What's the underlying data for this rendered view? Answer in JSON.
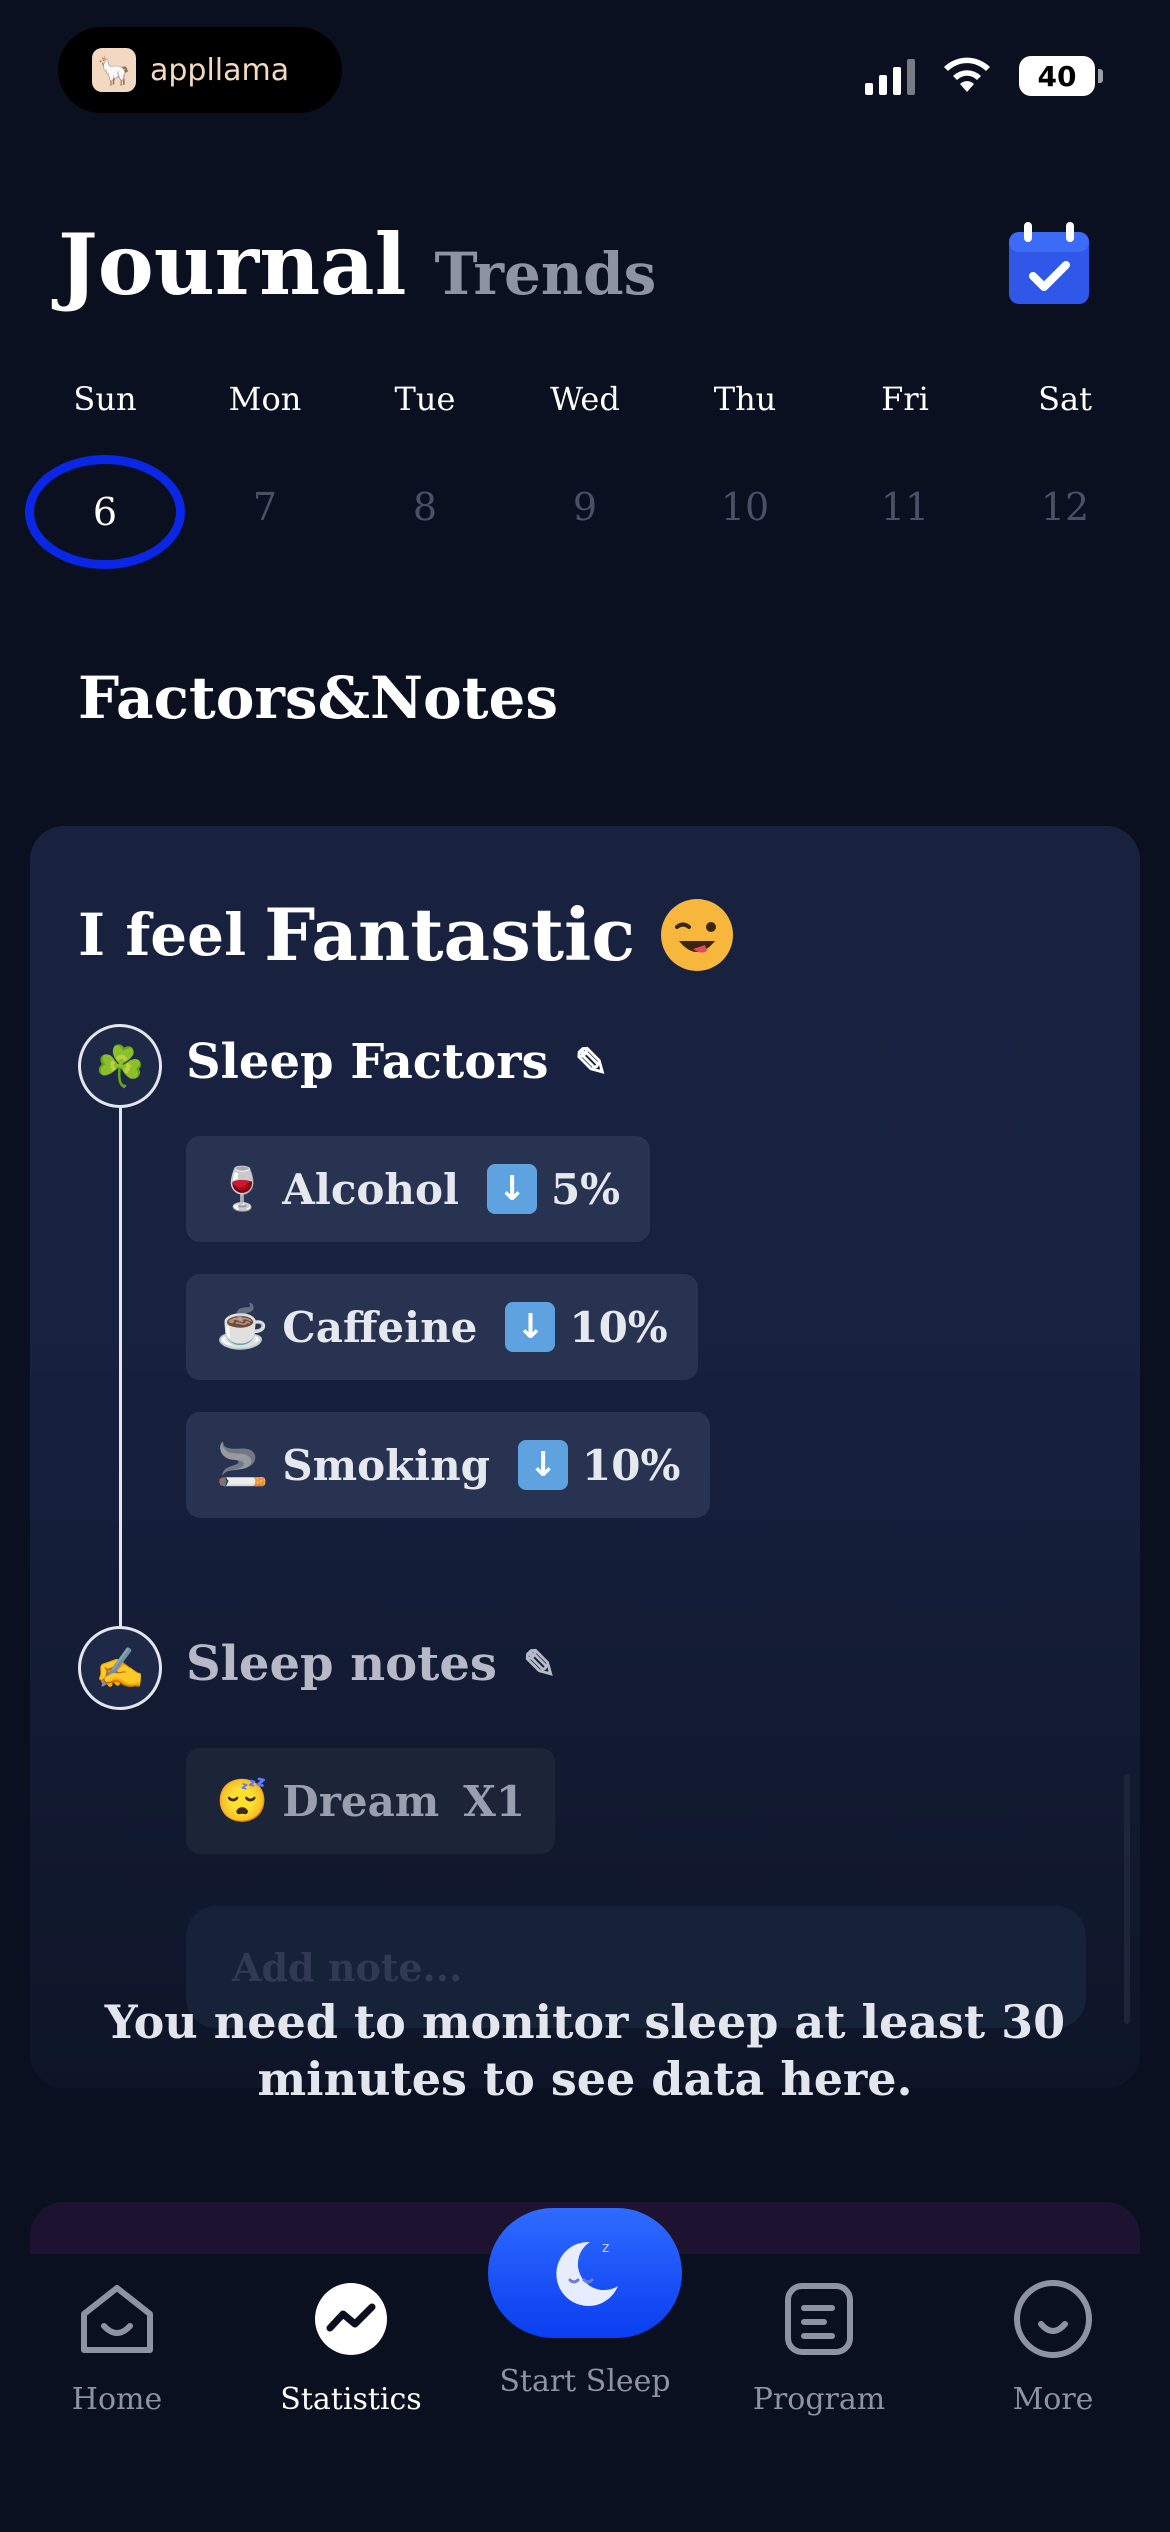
{
  "status_bar": {
    "brand": "appllama",
    "battery": "40"
  },
  "header": {
    "title": "Journal",
    "tab_trends": "Trends"
  },
  "week": {
    "days": [
      "Sun",
      "Mon",
      "Tue",
      "Wed",
      "Thu",
      "Fri",
      "Sat"
    ],
    "dates": [
      "6",
      "7",
      "8",
      "9",
      "10",
      "11",
      "12"
    ],
    "selected_index": 0
  },
  "section": {
    "title": "Factors&Notes"
  },
  "card": {
    "feel_prefix": "I feel",
    "feel_value": "Fantastic",
    "sleep_factors_title": "Sleep Factors",
    "factors": [
      {
        "emoji": "🍷",
        "label": "Alcohol",
        "value": "5%"
      },
      {
        "emoji": "☕",
        "label": "Caffeine",
        "value": "10%"
      },
      {
        "emoji": "🚬",
        "label": "Smoking",
        "value": "10%"
      }
    ],
    "sleep_notes_title": "Sleep notes",
    "notes": [
      {
        "emoji": "😴",
        "label": "Dream",
        "count": "X1"
      }
    ],
    "add_note_placeholder": "Add note...",
    "overlay_message": "You need to monitor sleep at least 30 minutes to see data here."
  },
  "tabbar": {
    "home": "Home",
    "statistics": "Statistics",
    "start_sleep": "Start Sleep",
    "program": "Program",
    "more": "More",
    "active": "statistics"
  },
  "colors": {
    "background": "#0b1020",
    "card": "#18223f",
    "accent_blue": "#0b27e6",
    "start_button": "#1a4dff"
  }
}
